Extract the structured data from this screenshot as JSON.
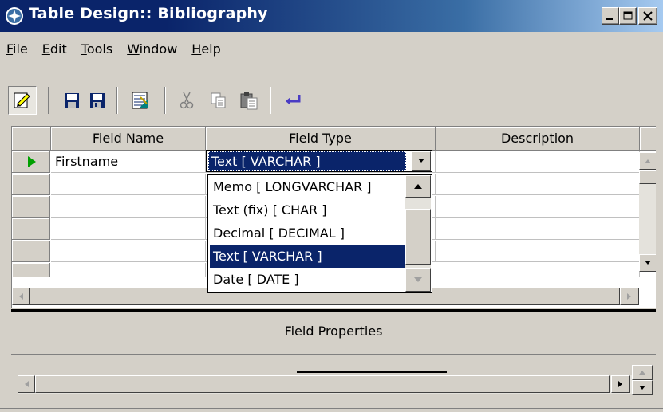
{
  "window": {
    "title": "Table Design:: Bibliography",
    "buttons": [
      "minimize",
      "maximize",
      "close"
    ]
  },
  "menu": {
    "items": [
      {
        "label": "File",
        "accel": "F"
      },
      {
        "label": "Edit",
        "accel": "E"
      },
      {
        "label": "Tools",
        "accel": "T"
      },
      {
        "label": "Window",
        "accel": "W"
      },
      {
        "label": "Help",
        "accel": "H"
      }
    ]
  },
  "toolbar": {
    "icons": [
      "edit-mode-icon",
      "save-icon",
      "save-as-icon",
      "index-design-icon",
      "cut-icon",
      "copy-icon",
      "paste-icon",
      "undo-icon"
    ]
  },
  "grid": {
    "headers": [
      "Field Name",
      "Field Type",
      "Description"
    ],
    "rows": [
      {
        "field_name": "Firstname",
        "field_type": "Text [ VARCHAR ]",
        "description": ""
      },
      {
        "field_name": "",
        "field_type": "",
        "description": ""
      },
      {
        "field_name": "",
        "field_type": "",
        "description": ""
      },
      {
        "field_name": "",
        "field_type": "",
        "description": ""
      },
      {
        "field_name": "",
        "field_type": "",
        "description": ""
      },
      {
        "field_name": "",
        "field_type": "",
        "description": ""
      }
    ]
  },
  "field_type_dropdown": {
    "selected": "Text [ VARCHAR ]",
    "options": [
      "Memo [ LONGVARCHAR ]",
      "Text (fix) [ CHAR ]",
      "Decimal [ DECIMAL ]",
      "Text [ VARCHAR ]",
      "Date [ DATE ]"
    ],
    "highlighted_index": 3
  },
  "properties": {
    "title": "Field Properties"
  },
  "colors": {
    "title_bar": "#0a246a",
    "selection": "#0a246a",
    "face": "#d4d0c8",
    "row_pointer": "#00a000"
  }
}
